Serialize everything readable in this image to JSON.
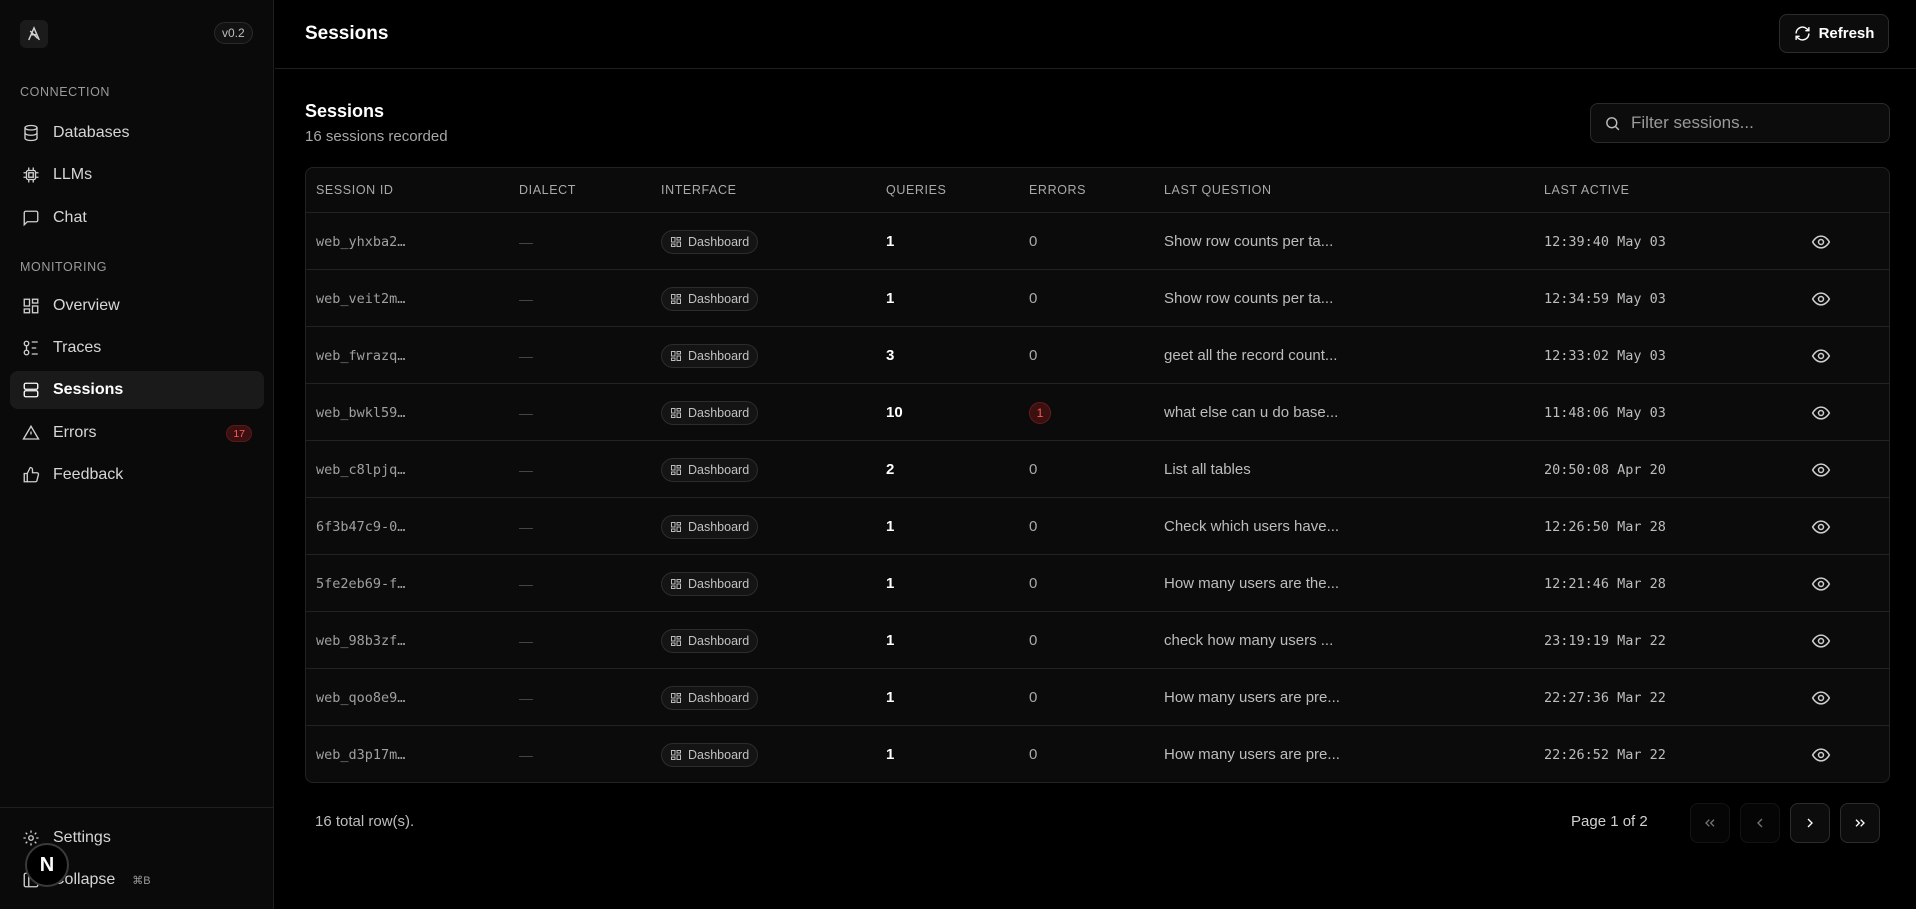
{
  "sidebar": {
    "version": "v0.2",
    "sections": {
      "connection": "CONNECTION",
      "monitoring": "MONITORING"
    },
    "items": {
      "databases": "Databases",
      "llms": "LLMs",
      "chat": "Chat",
      "overview": "Overview",
      "traces": "Traces",
      "sessions": "Sessions",
      "errors": "Errors",
      "errors_count": "17",
      "feedback": "Feedback"
    },
    "settings": "Settings",
    "collapse": "Collapse",
    "collapse_shortcut": "⌘B",
    "avatar_letter": "N"
  },
  "header": {
    "title": "Sessions",
    "refresh_label": "Refresh"
  },
  "main": {
    "title": "Sessions",
    "subtitle": "16 sessions recorded",
    "search_placeholder": "Filter sessions...",
    "columns": [
      "SESSION ID",
      "DIALECT",
      "INTERFACE",
      "QUERIES",
      "ERRORS",
      "LAST QUESTION",
      "LAST ACTIVE"
    ],
    "rows": [
      {
        "id": "web_yhxba2…",
        "dialect": "—",
        "interface": "Dashboard",
        "queries": "1",
        "errors": "0",
        "last_question": "Show row counts per ta...",
        "last_active": "12:39:40 May 03"
      },
      {
        "id": "web_veit2m…",
        "dialect": "—",
        "interface": "Dashboard",
        "queries": "1",
        "errors": "0",
        "last_question": "Show row counts per ta...",
        "last_active": "12:34:59 May 03"
      },
      {
        "id": "web_fwrazq…",
        "dialect": "—",
        "interface": "Dashboard",
        "queries": "3",
        "errors": "0",
        "last_question": "geet all the record count...",
        "last_active": "12:33:02 May 03"
      },
      {
        "id": "web_bwkl59…",
        "dialect": "—",
        "interface": "Dashboard",
        "queries": "10",
        "errors": "1",
        "last_question": "what else can u do base...",
        "last_active": "11:48:06 May 03"
      },
      {
        "id": "web_c8lpjq…",
        "dialect": "—",
        "interface": "Dashboard",
        "queries": "2",
        "errors": "0",
        "last_question": "List all tables",
        "last_active": "20:50:08 Apr 20"
      },
      {
        "id": "6f3b47c9-0…",
        "dialect": "—",
        "interface": "Dashboard",
        "queries": "1",
        "errors": "0",
        "last_question": "Check which users have...",
        "last_active": "12:26:50 Mar 28"
      },
      {
        "id": "5fe2eb69-f…",
        "dialect": "—",
        "interface": "Dashboard",
        "queries": "1",
        "errors": "0",
        "last_question": "How many users are the...",
        "last_active": "12:21:46 Mar 28"
      },
      {
        "id": "web_98b3zf…",
        "dialect": "—",
        "interface": "Dashboard",
        "queries": "1",
        "errors": "0",
        "last_question": "check how many users ...",
        "last_active": "23:19:19 Mar 22"
      },
      {
        "id": "web_qoo8e9…",
        "dialect": "—",
        "interface": "Dashboard",
        "queries": "1",
        "errors": "0",
        "last_question": "How many users are pre...",
        "last_active": "22:27:36 Mar 22"
      },
      {
        "id": "web_d3p17m…",
        "dialect": "—",
        "interface": "Dashboard",
        "queries": "1",
        "errors": "0",
        "last_question": "How many users are pre...",
        "last_active": "22:26:52 Mar 22"
      }
    ],
    "total_rows": "16 total row(s).",
    "page_info": "Page 1 of 2"
  }
}
